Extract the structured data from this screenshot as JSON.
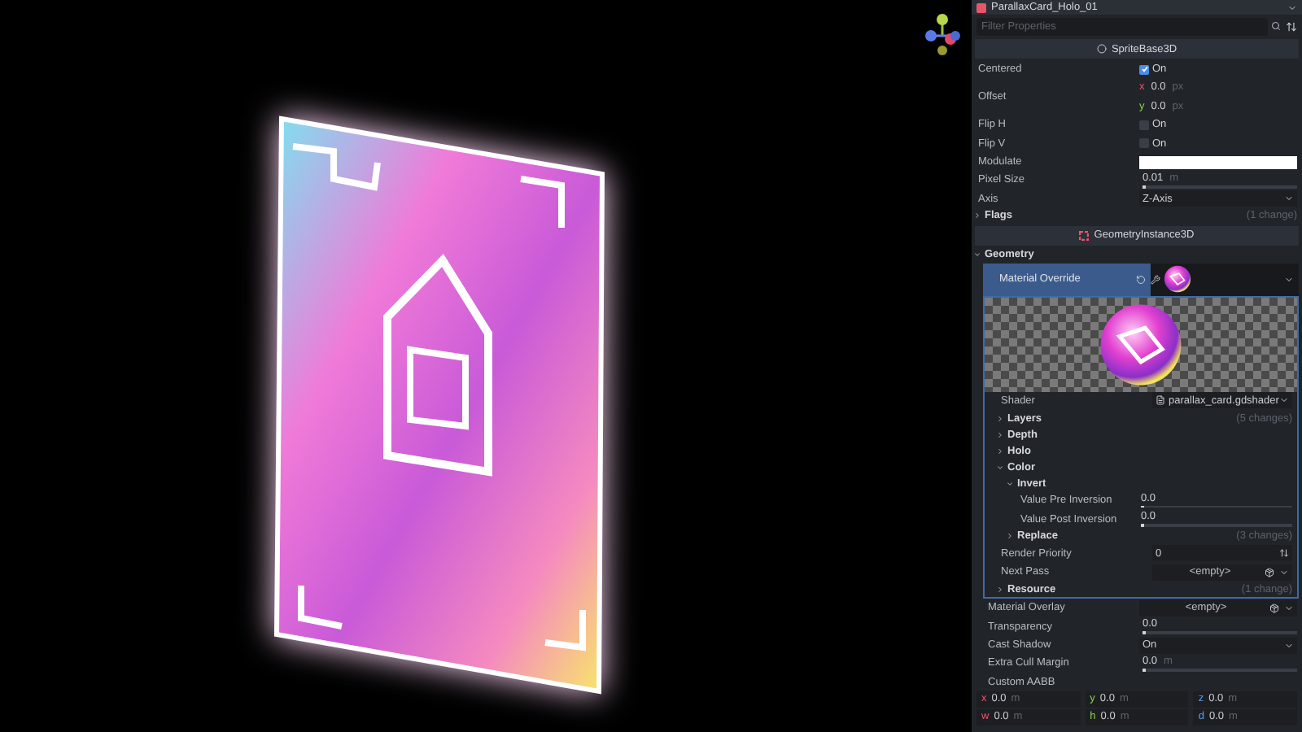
{
  "inspector": {
    "object_title": "ParallaxCard_Holo_01",
    "filter": {
      "placeholder": "Filter Properties"
    },
    "rows": [
      {
        "kind": "section",
        "label": "SpriteBase3D"
      },
      {
        "kind": "check",
        "label": "Centered",
        "checked": true,
        "value": "On"
      },
      {
        "kind": "vector",
        "label": "Offset",
        "fields": [
          {
            "axis": "x",
            "value": "0.0",
            "unit": "px"
          },
          {
            "axis": "y",
            "value": "0.0",
            "unit": "px"
          }
        ]
      },
      {
        "kind": "check",
        "label": "Flip H",
        "checked": false,
        "value": "On"
      },
      {
        "kind": "check",
        "label": "Flip V",
        "checked": false,
        "value": "On"
      },
      {
        "kind": "color",
        "label": "Modulate",
        "color": "#ffffff"
      },
      {
        "kind": "slider",
        "label": "Pixel Size",
        "value": "0.01",
        "unit": "m",
        "level": 0.01
      },
      {
        "kind": "select",
        "label": "Axis",
        "value": "Z-Axis"
      },
      {
        "kind": "group",
        "label": "Flags",
        "expanded": false,
        "note": "(1 change)"
      },
      {
        "kind": "section",
        "label": "GeometryInstance3D"
      },
      {
        "kind": "group",
        "label": "Geometry",
        "expanded": true,
        "children": [
          {
            "kind": "resource",
            "label": "Material Override",
            "expanded": true,
            "children": [
              {
                "kind": "preview"
              },
              {
                "kind": "resource",
                "label": "Shader",
                "value": "parallax_card.gdshader"
              },
              {
                "kind": "group",
                "label": "Layers",
                "expanded": false,
                "note": "(5 changes)"
              },
              {
                "kind": "group",
                "label": "Depth",
                "expanded": false
              },
              {
                "kind": "group",
                "label": "Holo",
                "expanded": false
              },
              {
                "kind": "group",
                "label": "Color",
                "expanded": true,
                "children": [
                  {
                    "kind": "group",
                    "label": "Invert",
                    "expanded": true,
                    "children": [
                      {
                        "kind": "slider",
                        "label": "Value Pre Inversion",
                        "value": "0.0",
                        "level": 0
                      },
                      {
                        "kind": "slider",
                        "label": "Value Post Inversion",
                        "value": "0.0",
                        "level": 0
                      }
                    ]
                  },
                  {
                    "kind": "group",
                    "label": "Replace",
                    "expanded": false,
                    "note": "(3 changes)"
                  }
                ]
              },
              {
                "kind": "number",
                "label": "Render Priority",
                "value": "0"
              },
              {
                "kind": "resource",
                "label": "Next Pass",
                "value": "<empty>"
              },
              {
                "kind": "group",
                "label": "Resource",
                "expanded": false,
                "note": "(1 change)"
              }
            ]
          },
          {
            "kind": "resource",
            "label": "Material Overlay",
            "value": "<empty>"
          },
          {
            "kind": "slider",
            "label": "Transparency",
            "value": "0.0",
            "level": 0
          },
          {
            "kind": "select",
            "label": "Cast Shadow",
            "value": "On"
          },
          {
            "kind": "slider",
            "label": "Extra Cull Margin",
            "value": "0.0",
            "unit": "m",
            "level": 0
          },
          {
            "kind": "aabb",
            "label": "Custom AABB",
            "fields": [
              {
                "axis": "x",
                "value": "0.0",
                "unit": "m"
              },
              {
                "axis": "y",
                "value": "0.0",
                "unit": "m"
              },
              {
                "axis": "z",
                "value": "0.0",
                "unit": "m"
              },
              {
                "axis": "w",
                "value": "0.0",
                "unit": "m"
              },
              {
                "axis": "h",
                "value": "0.0",
                "unit": "m"
              },
              {
                "axis": "d",
                "value": "0.0",
                "unit": "m"
              }
            ]
          }
        ]
      }
    ]
  }
}
